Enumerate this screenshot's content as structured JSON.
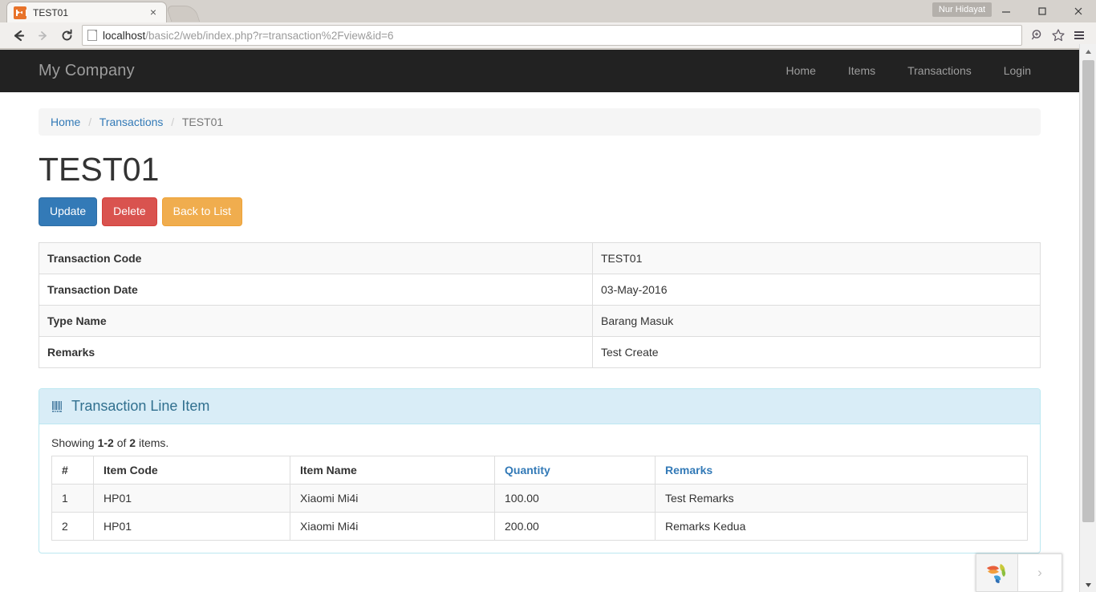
{
  "browser": {
    "tab": {
      "title": "TEST01",
      "favicon": "yii-favicon",
      "close_label": "×"
    },
    "newtab_label": "+",
    "profile_badge": "Nur Hidayat",
    "window_controls": {
      "minimize": "minimize-icon",
      "maximize": "maximize-icon",
      "close": "close-icon"
    },
    "nav": {
      "back": "back-arrow-icon",
      "forward": "forward-arrow-icon",
      "reload": "reload-icon"
    },
    "address": {
      "host": "localhost",
      "path": "/basic2/web/index.php?r=transaction%2Fview&id=6",
      "full": "localhost/basic2/web/index.php?r=transaction%2Fview&id=6",
      "page_icon": "page-icon"
    },
    "toolbar_icons": {
      "zoom": "zoom-magnifier-icon",
      "bookmark": "star-icon",
      "menu": "hamburger-menu-icon"
    }
  },
  "site": {
    "brand": "My Company",
    "nav_items": [
      {
        "label": "Home"
      },
      {
        "label": "Items"
      },
      {
        "label": "Transactions"
      },
      {
        "label": "Login"
      }
    ]
  },
  "breadcrumb": {
    "items": [
      {
        "label": "Home",
        "link": true
      },
      {
        "label": "Transactions",
        "link": true
      },
      {
        "label": "TEST01",
        "link": false
      }
    ],
    "separator": "/"
  },
  "page": {
    "title": "TEST01",
    "actions": [
      {
        "label": "Update",
        "style": "primary",
        "color": "#337ab7"
      },
      {
        "label": "Delete",
        "style": "danger",
        "color": "#d9534f"
      },
      {
        "label": "Back to List",
        "style": "warning",
        "color": "#f0ad4e"
      }
    ],
    "detail_rows": [
      {
        "label": "Transaction Code",
        "value": "TEST01"
      },
      {
        "label": "Transaction Date",
        "value": "03-May-2016"
      },
      {
        "label": "Type Name",
        "value": "Barang Masuk"
      },
      {
        "label": "Remarks",
        "value": "Test Create"
      }
    ]
  },
  "panel": {
    "icon": "barcode-icon",
    "title": "Transaction Line Item",
    "summary": {
      "prefix": "Showing",
      "range": "1-2",
      "middle": "of",
      "total": "2",
      "suffix": "items."
    },
    "grid": {
      "columns": [
        {
          "label": "#",
          "sortable": false
        },
        {
          "label": "Item Code",
          "sortable": false
        },
        {
          "label": "Item Name",
          "sortable": false
        },
        {
          "label": "Quantity",
          "sortable": true
        },
        {
          "label": "Remarks",
          "sortable": true
        }
      ],
      "rows": [
        {
          "num": "1",
          "item_code": "HP01",
          "item_name": "Xiaomi Mi4i",
          "quantity": "100.00",
          "remarks": "Test Remarks"
        },
        {
          "num": "2",
          "item_code": "HP01",
          "item_name": "Xiaomi Mi4i",
          "quantity": "200.00",
          "remarks": "Remarks Kedua"
        }
      ]
    }
  },
  "float_widget": {
    "logo": "zoho-petal-logo-icon",
    "expand_label": "›"
  },
  "scrollbar": {
    "up_label": "▲",
    "down_label": "▼"
  },
  "colors": {
    "navbar_bg": "#222222",
    "primary": "#337ab7",
    "danger": "#d9534f",
    "warning": "#f0ad4e",
    "panel_info_bg": "#d9edf7",
    "panel_info_border": "#bce8f1",
    "panel_info_text": "#31708f"
  }
}
